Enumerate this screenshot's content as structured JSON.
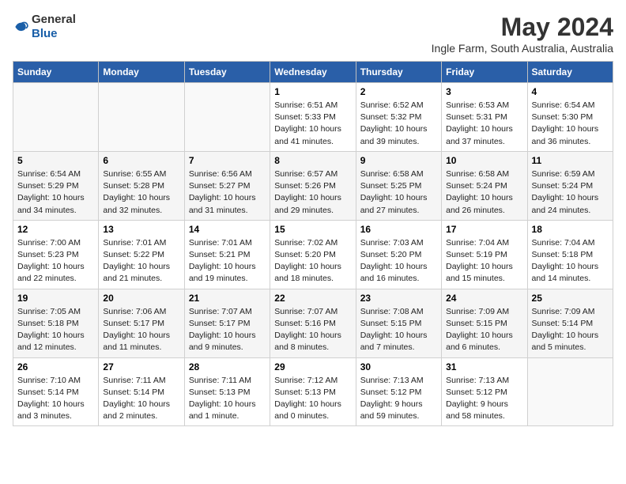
{
  "header": {
    "logo_general": "General",
    "logo_blue": "Blue",
    "title": "May 2024",
    "subtitle": "Ingle Farm, South Australia, Australia"
  },
  "days_of_week": [
    "Sunday",
    "Monday",
    "Tuesday",
    "Wednesday",
    "Thursday",
    "Friday",
    "Saturday"
  ],
  "weeks": [
    [
      {
        "day": "",
        "info": ""
      },
      {
        "day": "",
        "info": ""
      },
      {
        "day": "",
        "info": ""
      },
      {
        "day": "1",
        "info": "Sunrise: 6:51 AM\nSunset: 5:33 PM\nDaylight: 10 hours\nand 41 minutes."
      },
      {
        "day": "2",
        "info": "Sunrise: 6:52 AM\nSunset: 5:32 PM\nDaylight: 10 hours\nand 39 minutes."
      },
      {
        "day": "3",
        "info": "Sunrise: 6:53 AM\nSunset: 5:31 PM\nDaylight: 10 hours\nand 37 minutes."
      },
      {
        "day": "4",
        "info": "Sunrise: 6:54 AM\nSunset: 5:30 PM\nDaylight: 10 hours\nand 36 minutes."
      }
    ],
    [
      {
        "day": "5",
        "info": "Sunrise: 6:54 AM\nSunset: 5:29 PM\nDaylight: 10 hours\nand 34 minutes."
      },
      {
        "day": "6",
        "info": "Sunrise: 6:55 AM\nSunset: 5:28 PM\nDaylight: 10 hours\nand 32 minutes."
      },
      {
        "day": "7",
        "info": "Sunrise: 6:56 AM\nSunset: 5:27 PM\nDaylight: 10 hours\nand 31 minutes."
      },
      {
        "day": "8",
        "info": "Sunrise: 6:57 AM\nSunset: 5:26 PM\nDaylight: 10 hours\nand 29 minutes."
      },
      {
        "day": "9",
        "info": "Sunrise: 6:58 AM\nSunset: 5:25 PM\nDaylight: 10 hours\nand 27 minutes."
      },
      {
        "day": "10",
        "info": "Sunrise: 6:58 AM\nSunset: 5:24 PM\nDaylight: 10 hours\nand 26 minutes."
      },
      {
        "day": "11",
        "info": "Sunrise: 6:59 AM\nSunset: 5:24 PM\nDaylight: 10 hours\nand 24 minutes."
      }
    ],
    [
      {
        "day": "12",
        "info": "Sunrise: 7:00 AM\nSunset: 5:23 PM\nDaylight: 10 hours\nand 22 minutes."
      },
      {
        "day": "13",
        "info": "Sunrise: 7:01 AM\nSunset: 5:22 PM\nDaylight: 10 hours\nand 21 minutes."
      },
      {
        "day": "14",
        "info": "Sunrise: 7:01 AM\nSunset: 5:21 PM\nDaylight: 10 hours\nand 19 minutes."
      },
      {
        "day": "15",
        "info": "Sunrise: 7:02 AM\nSunset: 5:20 PM\nDaylight: 10 hours\nand 18 minutes."
      },
      {
        "day": "16",
        "info": "Sunrise: 7:03 AM\nSunset: 5:20 PM\nDaylight: 10 hours\nand 16 minutes."
      },
      {
        "day": "17",
        "info": "Sunrise: 7:04 AM\nSunset: 5:19 PM\nDaylight: 10 hours\nand 15 minutes."
      },
      {
        "day": "18",
        "info": "Sunrise: 7:04 AM\nSunset: 5:18 PM\nDaylight: 10 hours\nand 14 minutes."
      }
    ],
    [
      {
        "day": "19",
        "info": "Sunrise: 7:05 AM\nSunset: 5:18 PM\nDaylight: 10 hours\nand 12 minutes."
      },
      {
        "day": "20",
        "info": "Sunrise: 7:06 AM\nSunset: 5:17 PM\nDaylight: 10 hours\nand 11 minutes."
      },
      {
        "day": "21",
        "info": "Sunrise: 7:07 AM\nSunset: 5:17 PM\nDaylight: 10 hours\nand 9 minutes."
      },
      {
        "day": "22",
        "info": "Sunrise: 7:07 AM\nSunset: 5:16 PM\nDaylight: 10 hours\nand 8 minutes."
      },
      {
        "day": "23",
        "info": "Sunrise: 7:08 AM\nSunset: 5:15 PM\nDaylight: 10 hours\nand 7 minutes."
      },
      {
        "day": "24",
        "info": "Sunrise: 7:09 AM\nSunset: 5:15 PM\nDaylight: 10 hours\nand 6 minutes."
      },
      {
        "day": "25",
        "info": "Sunrise: 7:09 AM\nSunset: 5:14 PM\nDaylight: 10 hours\nand 5 minutes."
      }
    ],
    [
      {
        "day": "26",
        "info": "Sunrise: 7:10 AM\nSunset: 5:14 PM\nDaylight: 10 hours\nand 3 minutes."
      },
      {
        "day": "27",
        "info": "Sunrise: 7:11 AM\nSunset: 5:14 PM\nDaylight: 10 hours\nand 2 minutes."
      },
      {
        "day": "28",
        "info": "Sunrise: 7:11 AM\nSunset: 5:13 PM\nDaylight: 10 hours\nand 1 minute."
      },
      {
        "day": "29",
        "info": "Sunrise: 7:12 AM\nSunset: 5:13 PM\nDaylight: 10 hours\nand 0 minutes."
      },
      {
        "day": "30",
        "info": "Sunrise: 7:13 AM\nSunset: 5:12 PM\nDaylight: 9 hours\nand 59 minutes."
      },
      {
        "day": "31",
        "info": "Sunrise: 7:13 AM\nSunset: 5:12 PM\nDaylight: 9 hours\nand 58 minutes."
      },
      {
        "day": "",
        "info": ""
      }
    ]
  ]
}
